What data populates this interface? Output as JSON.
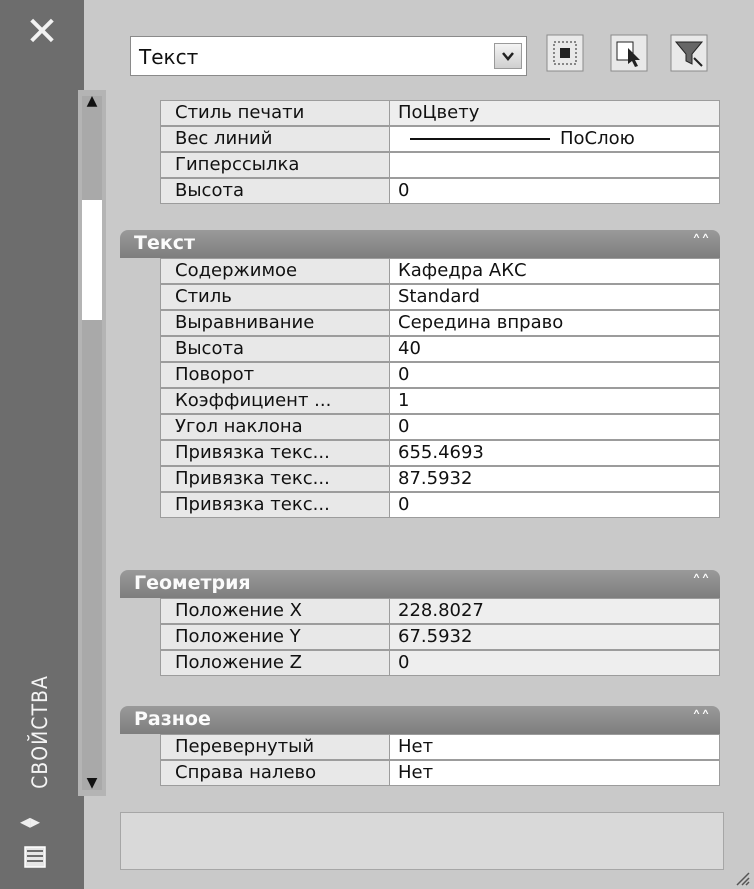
{
  "panel": {
    "vertical_title": "СВОЙСТВА",
    "close_glyph": "✕",
    "selected_object": "Текст"
  },
  "general_rows": [
    {
      "key": "Стиль печати",
      "value": "ПоЦвету",
      "readonly": true
    },
    {
      "key": "Вес линий",
      "value": "ПоСлою",
      "line": true
    },
    {
      "key": "Гиперссылка",
      "value": ""
    },
    {
      "key": "Высота",
      "value": "0"
    }
  ],
  "categories": {
    "text": {
      "title": "Текст",
      "rows": [
        {
          "key": "Содержимое",
          "value": "Кафедра АКС"
        },
        {
          "key": "Стиль",
          "value": "Standard"
        },
        {
          "key": "Выравнивание",
          "value": "Середина вправо"
        },
        {
          "key": "Высота",
          "value": "40"
        },
        {
          "key": "Поворот",
          "value": "0"
        },
        {
          "key": "Коэффициент ...",
          "value": "1"
        },
        {
          "key": "Угол наклона",
          "value": "0"
        },
        {
          "key": "Привязка текс...",
          "value": "655.4693"
        },
        {
          "key": "Привязка текс...",
          "value": "87.5932"
        },
        {
          "key": "Привязка текс...",
          "value": "0"
        }
      ]
    },
    "geometry": {
      "title": "Геометрия",
      "rows": [
        {
          "key": "Положение X",
          "value": "228.8027",
          "readonly": true
        },
        {
          "key": "Положение Y",
          "value": "67.5932",
          "readonly": true
        },
        {
          "key": "Положение Z",
          "value": "0",
          "readonly": true
        }
      ]
    },
    "misc": {
      "title": "Разное",
      "rows": [
        {
          "key": "Перевернутый",
          "value": "Нет"
        },
        {
          "key": "Справа налево",
          "value": "Нет"
        }
      ]
    }
  },
  "icons": {
    "toolbar": [
      "select-objects-icon",
      "quick-select-icon",
      "filter-icon"
    ],
    "collapse": "chevron-up-double-icon"
  }
}
